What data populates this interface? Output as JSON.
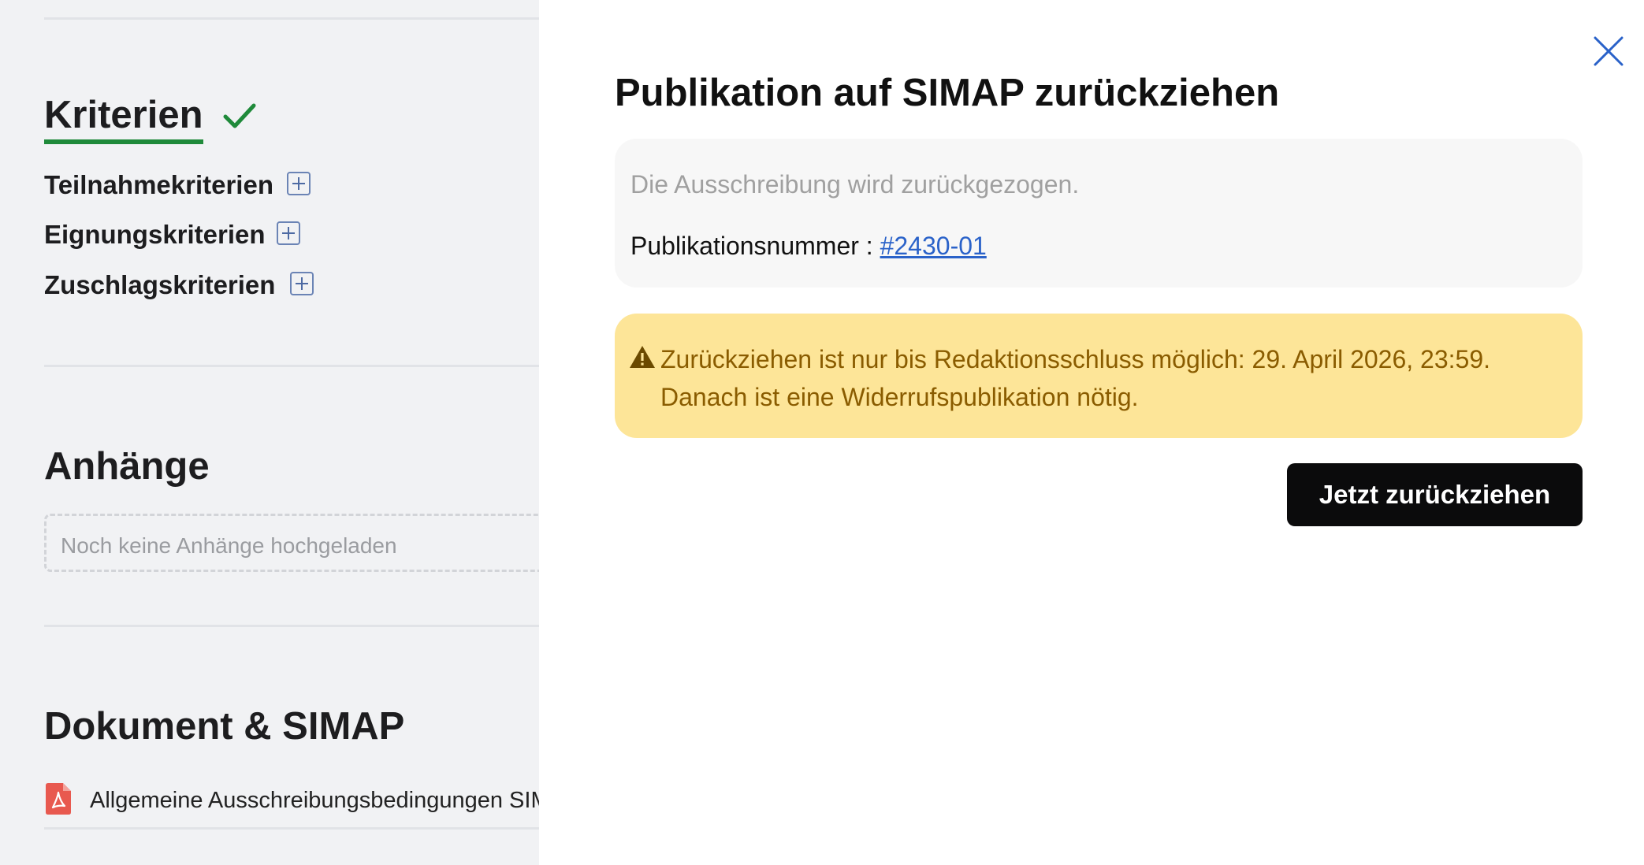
{
  "background_page": {
    "criteria_section": {
      "title": "Kriterien",
      "items": [
        {
          "label": "Teilnahmekriterien"
        },
        {
          "label": "Eignungskriterien"
        },
        {
          "label": "Zuschlagskriterien"
        }
      ]
    },
    "attachments_section": {
      "title": "Anhänge",
      "empty_text": "Noch keine Anhänge hochgeladen"
    },
    "document_section": {
      "title": "Dokument & SIMAP",
      "documents": [
        {
          "label": "Allgemeine Ausschreibungsbedingungen SIMAP",
          "icon": "pdf-icon"
        }
      ]
    }
  },
  "modal": {
    "title": "Publikation auf SIMAP zurückziehen",
    "info": {
      "text": "Die Ausschreibung wird zurückgezogen.",
      "pub_label": "Publikationsnummer : ",
      "pub_number": "#2430-01"
    },
    "warning": {
      "icon": "warning-icon",
      "text": "Zurückziehen ist nur bis Redaktionsschluss möglich: 29. April 2026, 23:59. Danach ist eine Widerrufspublikation nötig."
    },
    "submit_label": "Jetzt zurückziehen",
    "close_icon": "close-icon"
  },
  "colors": {
    "accent_green": "#1f8a3a",
    "link_blue": "#2a62c9",
    "warning_bg": "#fde598",
    "warning_text": "#8a5c00",
    "button_bg": "#0b0b0c"
  }
}
